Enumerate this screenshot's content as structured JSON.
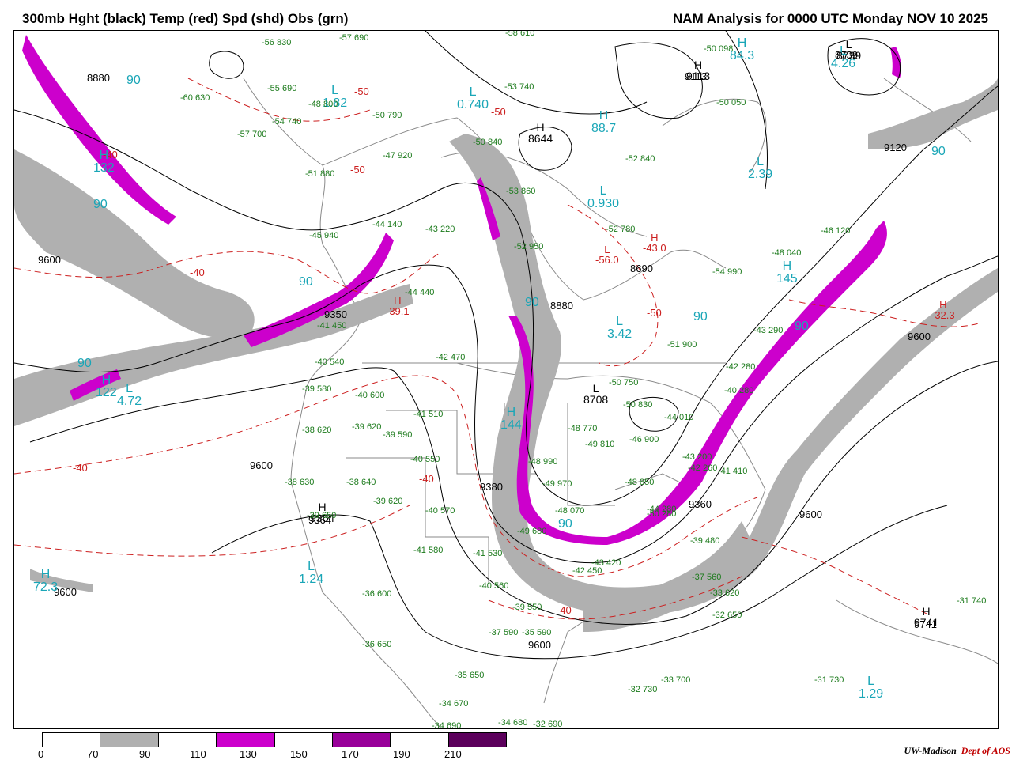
{
  "header": {
    "title_left": "300mb Hght (black) Temp (red) Spd (shd) Obs (grn)",
    "title_right": "NAM Analysis for 0000 UTC Monday  NOV 10 2025"
  },
  "colors": {
    "height_contour": "#000000",
    "temperature_contour": "#cc1f1f",
    "speed_label": "#1aa6b7",
    "observation": "#1b7a1b",
    "map_borders": "#888888"
  },
  "height_labels": [
    "8880",
    "9120",
    "9600",
    "9350",
    "8880",
    "8690",
    "9360",
    "9600",
    "9600",
    "9600",
    "9600",
    "9120",
    "8739",
    "9113",
    "9600",
    "9741",
    "9364",
    "9380"
  ],
  "temperature_labels": [
    "-40",
    "-40",
    "-40",
    "-50",
    "-50",
    "-50",
    "-40",
    "-40",
    "-50"
  ],
  "speed_labels": [
    "90",
    "90",
    "90",
    "90",
    "90",
    "90",
    "90",
    "90",
    "90",
    "90"
  ],
  "high_low_centers": [
    {
      "letter": "L",
      "value": "0.740"
    },
    {
      "letter": "H",
      "value": "88.7"
    },
    {
      "letter": "L",
      "value": "0.930"
    },
    {
      "letter": "L",
      "value": "2.39"
    },
    {
      "letter": "L",
      "value": "3.42"
    },
    {
      "letter": "L",
      "value": "1.24"
    },
    {
      "letter": "L",
      "value": "4.72"
    },
    {
      "letter": "H",
      "value": "122"
    },
    {
      "letter": "H",
      "value": "144"
    },
    {
      "letter": "H",
      "value": "145"
    },
    {
      "letter": "H",
      "value": "72.3"
    },
    {
      "letter": "L",
      "value": "1.29"
    },
    {
      "letter": "H",
      "value": "132"
    },
    {
      "letter": "L",
      "value": "4.26"
    },
    {
      "letter": "H",
      "value": "84.3"
    },
    {
      "letter": "L",
      "value": "1.82"
    },
    {
      "letter": "H",
      "value": "-32.3"
    },
    {
      "letter": "H",
      "value": "-39.1"
    },
    {
      "letter": "L",
      "value": "-56.0"
    },
    {
      "letter": "H",
      "value": "-43.0"
    },
    {
      "letter": "H",
      "value": "8644"
    },
    {
      "letter": "H",
      "value": "9113"
    },
    {
      "letter": "H",
      "value": "9741"
    },
    {
      "letter": "H",
      "value": "9364"
    },
    {
      "letter": "L",
      "value": "8739"
    },
    {
      "letter": "L",
      "value": "8708"
    }
  ],
  "observations": [
    "-56 830",
    "-57 690",
    "-58 610",
    "-60 630",
    "-55 690",
    "-48 800",
    "-54 740",
    "-57 700",
    "-50 790",
    "-53 740",
    "-47 920",
    "-51 880",
    "-50 840",
    "-52 840",
    "-53 860",
    "-45 940",
    "-44 140",
    "-43 220",
    "-52 950",
    "-52 780",
    "-48 040",
    "-46 120",
    "-54 990",
    "-50 050",
    "-50 098",
    "-44 440",
    "-42 470",
    "-40 540",
    "-41 450",
    "-39 580",
    "-40 600",
    "-38 620",
    "-39 620",
    "-39 590",
    "-41 510",
    "-38 630",
    "-38 640",
    "-39 620",
    "-40 550",
    "-40 570",
    "-39 650",
    "-41 580",
    "-41 530",
    "-40 560",
    "-39 550",
    "-37 590",
    "-35 590",
    "-36 600",
    "-36 650",
    "-35 650",
    "-34 670",
    "-34 690",
    "-34 680",
    "-32 690",
    "-32 730",
    "-33 700",
    "-31 730",
    "-31 740",
    "-33 620",
    "-32 650",
    "-37 560",
    "-39 480",
    "-40 280",
    "-41 410",
    "-43 200",
    "-42 260",
    "-44 280",
    "-51 900",
    "-50 750",
    "-50 830",
    "-48 850",
    "-49 810",
    "-48 770",
    "-49 970",
    "-48 990",
    "-49 680",
    "-50 280",
    "-43 420",
    "-42 450",
    "-48 070",
    "-44 010",
    "-46 900",
    "-43 290",
    "-42 280"
  ],
  "legend": {
    "ticks": [
      "0",
      "70",
      "90",
      "110",
      "130",
      "150",
      "170",
      "190",
      "210"
    ],
    "colors": [
      "#ffffff",
      "#b0b0b0",
      "#ffffff",
      "#cc00cc",
      "#ffffff",
      "#99009a",
      "#ffffff",
      "#5c005c"
    ]
  },
  "credit": {
    "org": "UW-Madison",
    "dept": "Dept of AOS"
  }
}
